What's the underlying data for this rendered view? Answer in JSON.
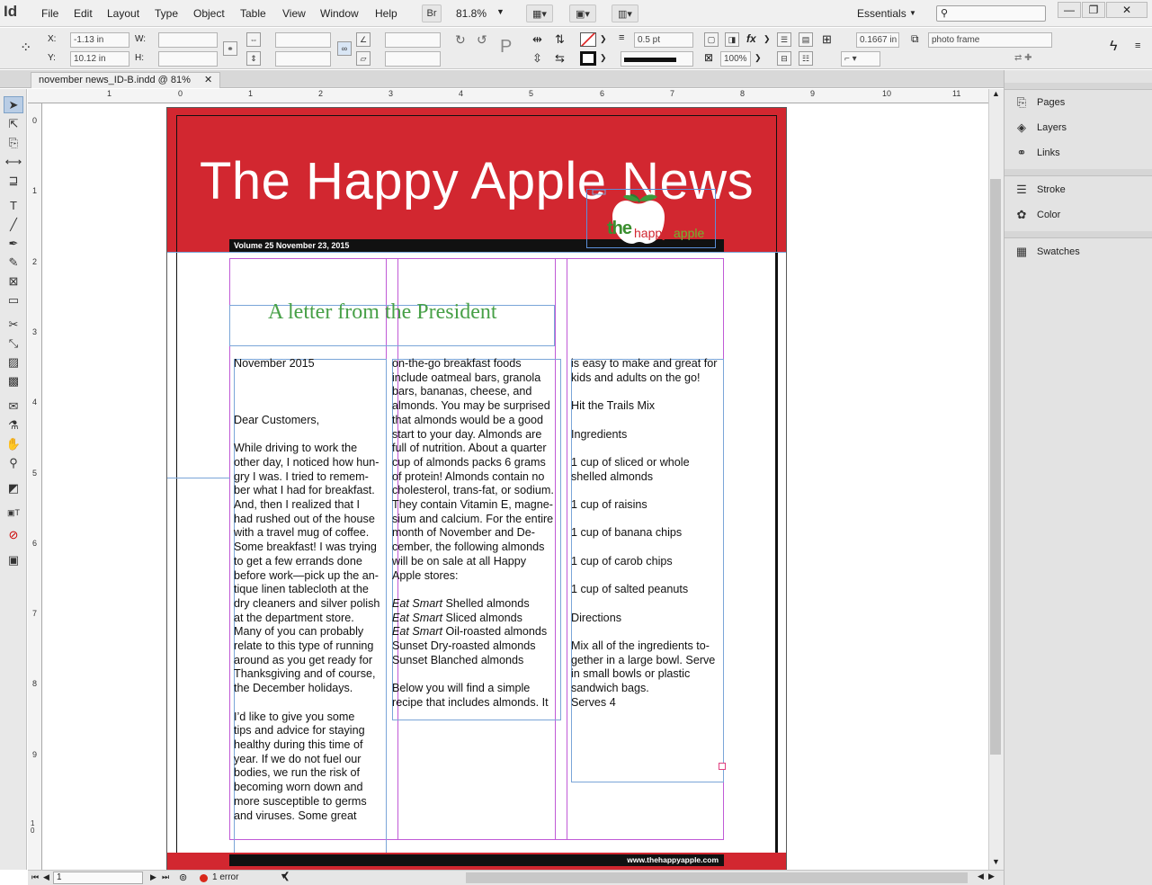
{
  "app": {
    "logo": "Id"
  },
  "menu": [
    "File",
    "Edit",
    "Layout",
    "Type",
    "Object",
    "Table",
    "View",
    "Window",
    "Help"
  ],
  "toolbar": {
    "bridge": "Br",
    "zoom": "81.8%",
    "workspace": "Essentials"
  },
  "control": {
    "x_label": "X:",
    "x_value": "-1.13 in",
    "y_label": "Y:",
    "y_value": "10.12 in",
    "w_label": "W:",
    "h_label": "H:",
    "stroke_weight": "0.5 pt",
    "opacity": "100%",
    "offset": "0.1667 in",
    "object_style": "photo frame"
  },
  "document_tab": {
    "label": "november news_ID-B.indd @ 81%"
  },
  "ruler_top": [
    "1",
    "0",
    "1",
    "2",
    "3",
    "4",
    "5",
    "6",
    "7",
    "8",
    "9",
    "10",
    "11"
  ],
  "ruler_left": [
    "0",
    "1",
    "2",
    "3",
    "4",
    "5",
    "6",
    "7",
    "8",
    "9",
    "1 0"
  ],
  "dock": {
    "pages": "Pages",
    "layers": "Layers",
    "links": "Links",
    "stroke": "Stroke",
    "color": "Color",
    "swatches": "Swatches"
  },
  "status": {
    "page": "1",
    "errors": "1 error"
  },
  "newsletter": {
    "title": "The Happy Apple News",
    "volume": "Volume 25 November 23, 2015",
    "logo_the": "the",
    "logo_happy": "happy",
    "logo_apple": "apple",
    "letter_title": "A letter from the President",
    "footer_url": "www.thehappyapple.com",
    "col1": "November 2015\n\n\n\nDear Customers,\n\nWhile driving to work the\nother day, I noticed how hun-\ngry I was. I tried to remem-\nber what I had for breakfast.\nAnd, then I realized that I\nhad rushed out of the house\nwith a travel mug of coffee.\nSome breakfast! I was trying\nto get a few errands done\nbefore work—pick up the an-\ntique linen tablecloth at the\ndry cleaners and silver polish\nat the department store.\nMany of you can probably\nrelate to this type of running\naround as you get ready for\nThanksgiving and of course,\nthe December holidays.\n\nI’d like to give you some\ntips and advice for staying\nhealthy during this time of\nyear. If we do not fuel our\nbodies, we run the risk of\nbecoming worn down and\nmore susceptible to germs\nand viruses. Some great",
    "col2a": "on-the-go breakfast foods\ninclude oatmeal bars, granola\nbars, bananas, cheese, and\nalmonds. You may be surprised\nthat almonds would be a good\nstart to your day. Almonds are\nfull of nutrition. About a quarter\ncup of almonds packs 6 grams\nof protein! Almonds contain no\ncholesterol, trans-fat, or sodium.\nThey contain Vitamin E, magne-\nsium and calcium. For the entire\nmonth of November and De-\ncember, the following almonds\nwill be on sale at all Happy\nApple stores:",
    "eat_smart": "Eat Smart",
    "list": [
      " Shelled almonds",
      " Sliced almonds",
      " Oil-roasted almonds"
    ],
    "list2": [
      "Sunset Dry-roasted almonds",
      "Sunset Blanched almonds"
    ],
    "col2b": "Below you will find a simple\nrecipe that includes almonds. It",
    "col3": "is easy to make and great for\nkids and adults on the go!\n\nHit the Trails Mix\n\nIngredients\n\n1 cup of sliced or whole\nshelled almonds\n\n1 cup of raisins\n\n1 cup of banana chips\n\n1 cup of carob chips\n\n1 cup of salted peanuts\n\nDirections\n\nMix all of the ingredients to-\ngether in a large bowl. Serve\nin small bowls or plastic\nsandwich bags.\nServes 4"
  },
  "colors": {
    "accent_red": "#d22730",
    "green": "#47a047",
    "frame_blue": "#7aa5d8",
    "margin_magenta": "#c05ad6"
  }
}
